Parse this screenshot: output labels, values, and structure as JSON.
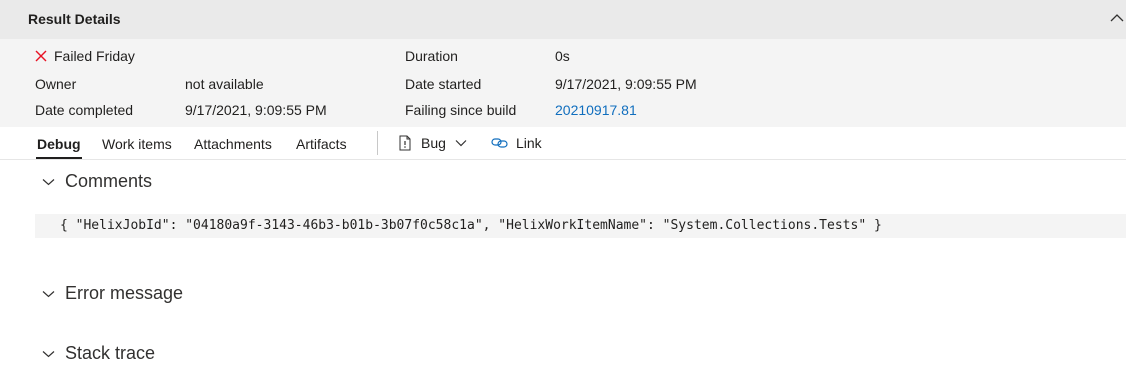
{
  "header": {
    "title": "Result Details"
  },
  "summary": {
    "outcome": "Failed Friday",
    "owner_label": "Owner",
    "owner_value": "not available",
    "date_completed_label": "Date completed",
    "date_completed_value": "9/17/2021, 9:09:55 PM",
    "duration_label": "Duration",
    "duration_value": "0s",
    "date_started_label": "Date started",
    "date_started_value": "9/17/2021, 9:09:55 PM",
    "failing_since_label": "Failing since build",
    "failing_since_value": "20210917.81"
  },
  "tabs": [
    {
      "label": "Debug",
      "active": true
    },
    {
      "label": "Work items"
    },
    {
      "label": "Attachments"
    },
    {
      "label": "Artifacts"
    }
  ],
  "actions": {
    "bug_label": "Bug",
    "link_label": "Link"
  },
  "sections": {
    "comments": "Comments",
    "comment_text": "{ \"HelixJobId\": \"04180a9f-3143-46b3-b01b-3b07f0c58c1a\", \"HelixWorkItemName\": \"System.Collections.Tests\" }",
    "error_message": "Error message",
    "stack_trace": "Stack trace"
  },
  "colors": {
    "link": "#106ebe",
    "fail": "#e81123",
    "header_bg": "#eaeaea",
    "summary_bg": "#f4f4f4"
  }
}
